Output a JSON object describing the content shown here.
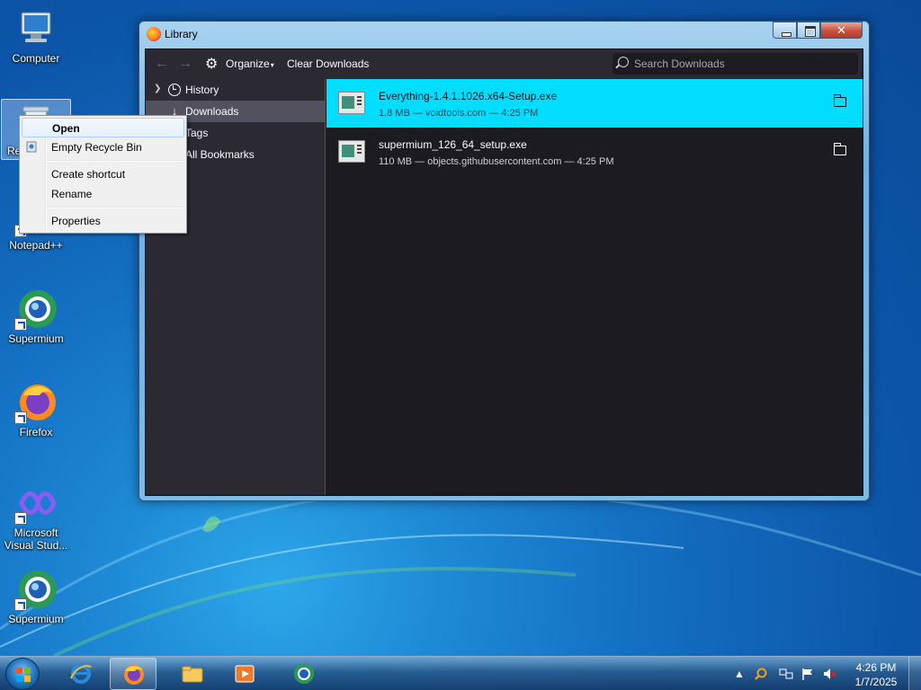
{
  "desktop": {
    "icons": [
      {
        "label": "Computer"
      },
      {
        "label": "Re"
      },
      {
        "label": "Notepad++"
      },
      {
        "label": "Supermium"
      },
      {
        "label": "Firefox"
      },
      {
        "label": "Microsoft Visual Stud..."
      },
      {
        "label": "Supermium"
      }
    ]
  },
  "context_menu": {
    "items": [
      {
        "label": "Open",
        "default": true
      },
      {
        "label": "Empty Recycle Bin"
      },
      {
        "label": "Create shortcut"
      },
      {
        "label": "Rename"
      },
      {
        "label": "Properties"
      }
    ]
  },
  "library_window": {
    "title": "Library",
    "close_glyph": "✕",
    "toolbar": {
      "organize_label": "Organize",
      "clear_downloads_label": "Clear Downloads",
      "search_placeholder": "Search Downloads"
    },
    "sidebar": {
      "items": [
        {
          "label": "History",
          "icon": "clock-icon"
        },
        {
          "label": "Downloads",
          "icon": "download-arrow-icon",
          "selected": true
        },
        {
          "label": "Tags",
          "icon": "tag-icon"
        },
        {
          "label": "All Bookmarks",
          "icon": "star-icon"
        }
      ]
    },
    "downloads": [
      {
        "filename": "Everything-1.4.1.1026.x64-Setup.exe",
        "meta": "1.8 MB — voidtools.com — 4:25 PM",
        "selected": true
      },
      {
        "filename": "supermium_126_64_setup.exe",
        "meta": "110 MB — objects.githubusercontent.com — 4:25 PM",
        "selected": false
      }
    ]
  },
  "taskbar": {
    "pinned": [
      "internet-explorer",
      "firefox",
      "file-explorer",
      "media-player",
      "supermium"
    ],
    "active": "firefox",
    "clock": {
      "time": "4:26 PM",
      "date": "1/7/2025"
    }
  },
  "colors": {
    "selection_accent": "#00ddff",
    "window_bg": "#1c1b22",
    "sidebar_bg": "#2b2a33"
  }
}
